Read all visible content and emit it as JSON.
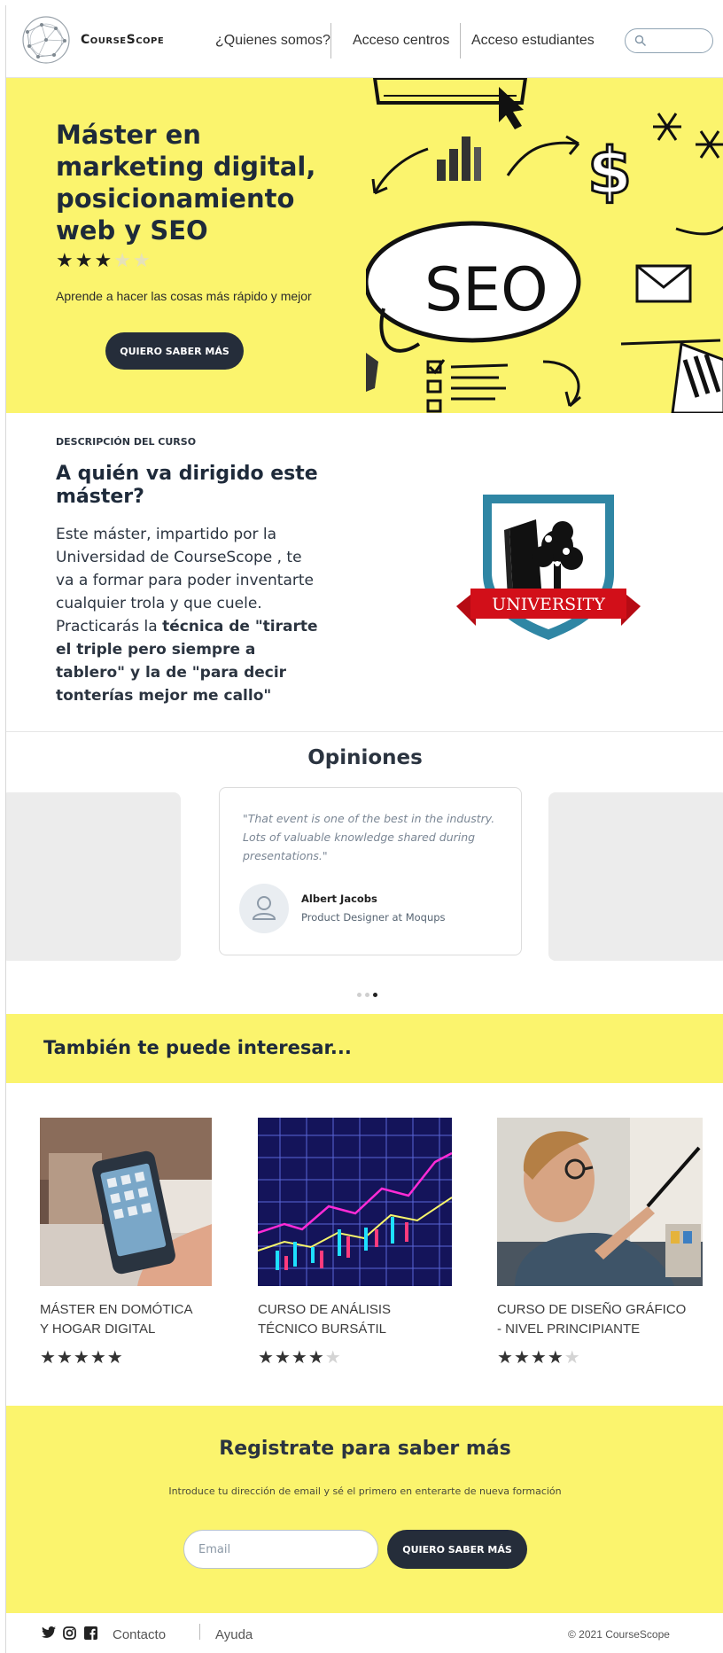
{
  "brand": "CourseScope",
  "nav": {
    "links": [
      "¿Quienes somos?",
      "Acceso centros",
      "Acceso estudiantes"
    ],
    "search_placeholder": ""
  },
  "hero": {
    "title": "Máster en marketing digital, posicionamiento web y SEO",
    "rating": 3,
    "rating_max": 5,
    "subtitle": "Aprende a hacer las cosas más rápido y mejor",
    "cta": "QUIERO SABER MÁS",
    "image_text": "SEO"
  },
  "description": {
    "kicker": "DESCRIPCIÓN DEL CURSO",
    "title": "A quién va dirigido este máster?",
    "body_intro": "Este máster, impartido por la Universidad de CourseScope , te va a formar para poder inventarte cualquier trola y que cuele. Practicarás la ",
    "body_bold": "técnica de \"tirarte el triple pero siempre a tablero\" y la de \"para decir tonterías mejor me callo\"",
    "crest_label": "UNIVERSITY"
  },
  "opinions": {
    "title": "Opiniones",
    "quote": "\"That event is one of the best in the industry. Lots of valuable knowledge shared during presentations.\"",
    "author": "Albert Jacobs",
    "role": "Product Designer at Moqups",
    "active_dot": 3,
    "dot_count": 3
  },
  "related": {
    "title": "También te puede interesar...",
    "courses": [
      {
        "name": "MÁSTER EN DOMÓTICA Y HOGAR DIGITAL",
        "rating": 5
      },
      {
        "name": "CURSO DE ANÁLISIS TÉCNICO BURSÁTIL",
        "rating": 4
      },
      {
        "name": "CURSO DE DISEÑO GRÁFICO - NIVEL PRINCIPIANTE",
        "rating": 4
      }
    ]
  },
  "register": {
    "title": "Registrate para saber más",
    "subtitle": "Introduce tu dirección de email y sé el primero en enterarte de nueva formación",
    "email_placeholder": "Email",
    "cta": "QUIERO SABER MÁS"
  },
  "footer": {
    "links": [
      "Contacto",
      "Ayuda"
    ],
    "copyright": "© 2021 CourseScope"
  },
  "colors": {
    "accent_yellow": "#fbf46d",
    "dark_button": "#252d3a"
  }
}
